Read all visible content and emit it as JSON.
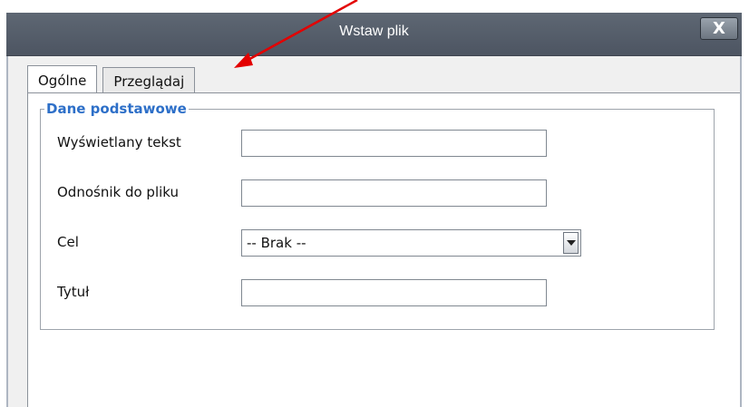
{
  "dialog": {
    "title": "Wstaw plik",
    "close_label": "X"
  },
  "tabs": [
    {
      "label": "Ogólne",
      "active": true
    },
    {
      "label": "Przeglądaj",
      "active": false
    }
  ],
  "fieldset": {
    "legend": "Dane podstawowe",
    "fields": {
      "display_text": {
        "label": "Wyświetlany tekst",
        "value": ""
      },
      "file_link": {
        "label": "Odnośnik do pliku",
        "value": ""
      },
      "target": {
        "label": "Cel",
        "selected": "-- Brak --"
      },
      "title": {
        "label": "Tytuł",
        "value": ""
      }
    }
  },
  "colors": {
    "titlebar": "#56606b",
    "legend": "#2d6fc8",
    "annotation_arrow": "#e30000"
  },
  "annotation": {
    "type": "arrow",
    "points_to": "Przeglądaj tab"
  }
}
